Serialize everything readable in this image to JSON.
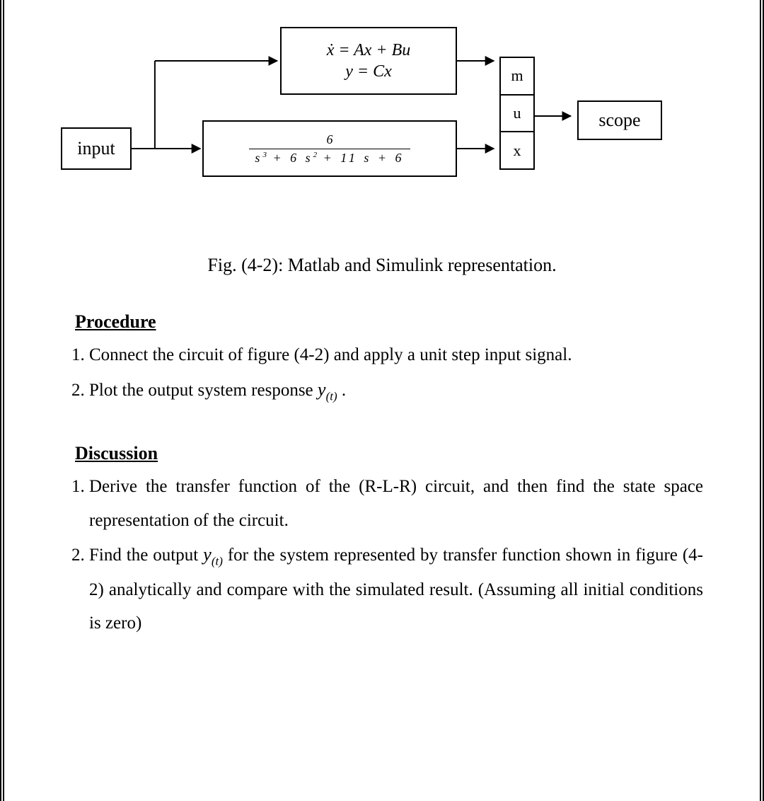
{
  "diagram": {
    "input_label": "input",
    "statespace_eq1": "ẋ = Ax + Bu",
    "statespace_eq2": "y = Cx",
    "tf_numerator": "6",
    "tf_denominator_html": "s<sup>3</sup> + 6 s<sup>2</sup> + 11 s + 6",
    "mux_labels": [
      "m",
      "u",
      "x"
    ],
    "scope_label": "scope"
  },
  "caption": "Fig. (4-2): Matlab and Simulink representation.",
  "procedure": {
    "heading": "Procedure",
    "items": [
      "Connect the circuit of figure (4-2) and apply a unit step input signal.",
      "Plot the output system response <span class=\"yt\">y<sub>(t)</sub></span> ."
    ]
  },
  "discussion": {
    "heading": "Discussion",
    "items": [
      "Derive the transfer function of the (R-L-R) circuit, and then find the state space representation of the circuit.",
      "Find the output <span class=\"yt\">y<sub>(t)</sub></span> for the system represented by transfer function shown in figure (4-2) analytically and compare with the simulated result. (Assuming all initial conditions is zero)"
    ]
  }
}
